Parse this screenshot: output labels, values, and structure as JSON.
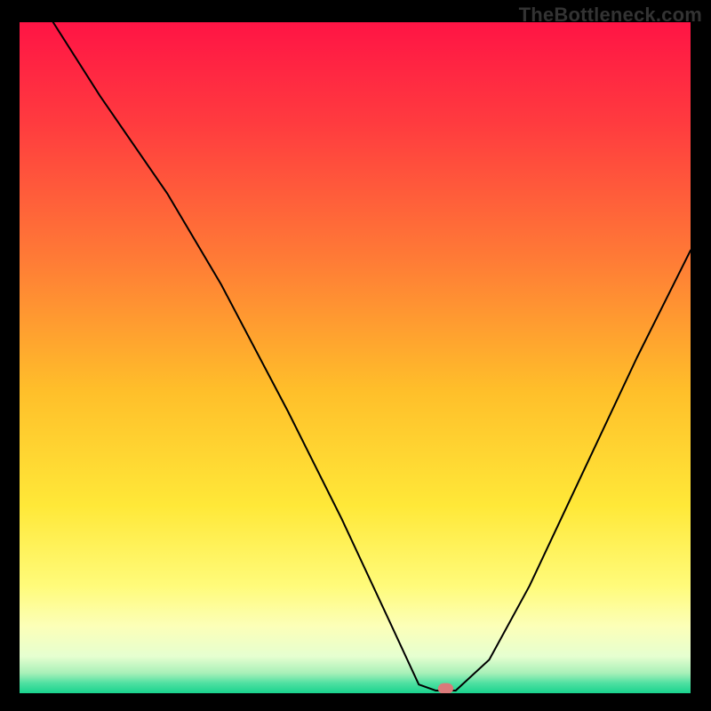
{
  "watermark": "TheBottleneck.com",
  "chart_data": {
    "type": "line",
    "title": "",
    "xlabel": "",
    "ylabel": "",
    "xlim": [
      0,
      100
    ],
    "ylim": [
      0,
      100
    ],
    "gradient_stops": [
      {
        "offset": 0.0,
        "color": "#ff1445"
      },
      {
        "offset": 0.15,
        "color": "#ff3b3f"
      },
      {
        "offset": 0.35,
        "color": "#ff7a36"
      },
      {
        "offset": 0.55,
        "color": "#ffbf2a"
      },
      {
        "offset": 0.72,
        "color": "#ffe838"
      },
      {
        "offset": 0.84,
        "color": "#fffb7a"
      },
      {
        "offset": 0.9,
        "color": "#fcffb8"
      },
      {
        "offset": 0.945,
        "color": "#e6ffd0"
      },
      {
        "offset": 0.97,
        "color": "#a8f0b8"
      },
      {
        "offset": 0.985,
        "color": "#4fe0a1"
      },
      {
        "offset": 1.0,
        "color": "#19d38e"
      }
    ],
    "series": [
      {
        "name": "bottleneck-curve",
        "x": [
          5,
          12,
          22,
          30,
          40,
          48,
          55,
          59.5,
          62,
          65,
          70,
          76,
          84,
          92,
          100
        ],
        "y": [
          100,
          89,
          74.5,
          61,
          42,
          26,
          11,
          1.3,
          0.4,
          0.4,
          5,
          16,
          33,
          50,
          66
        ]
      }
    ],
    "marker": {
      "x": 63.5,
      "y": 0.7,
      "w": 2.3,
      "h": 1.6
    }
  }
}
